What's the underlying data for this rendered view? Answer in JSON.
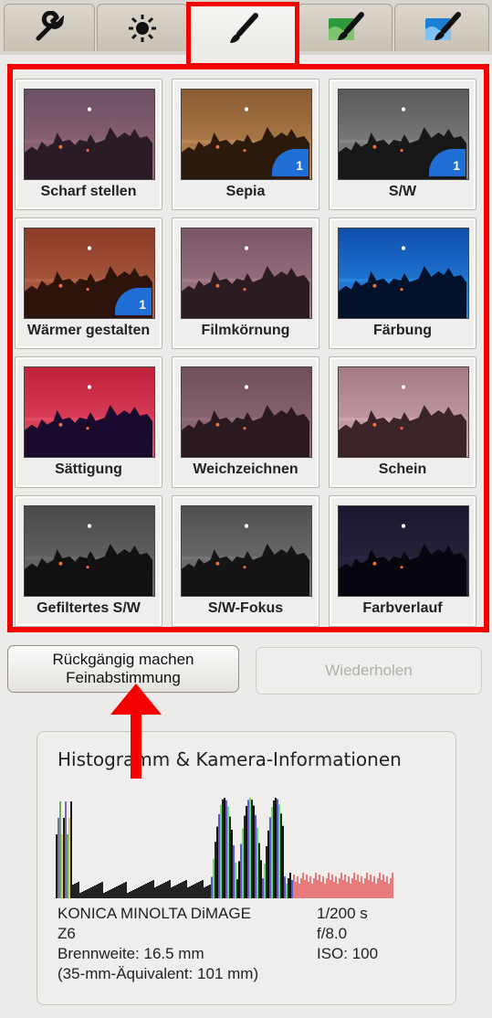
{
  "tabs": [
    {
      "name": "tab-tools",
      "icon": "wrench-icon",
      "active": false
    },
    {
      "name": "tab-adjust",
      "icon": "brightness-icon",
      "active": false
    },
    {
      "name": "tab-effects",
      "icon": "brush-icon",
      "active": true
    },
    {
      "name": "tab-effects-green",
      "icon": "brush-green-icon",
      "active": false
    },
    {
      "name": "tab-effects-blue",
      "icon": "brush-blue-icon",
      "active": false
    }
  ],
  "effects": [
    {
      "label": "Scharf stellen",
      "badge": null
    },
    {
      "label": "Sepia",
      "badge": "1"
    },
    {
      "label": "S/W",
      "badge": "1"
    },
    {
      "label": "Wärmer gestalten",
      "badge": "1"
    },
    {
      "label": "Filmkörnung",
      "badge": null
    },
    {
      "label": "Färbung",
      "badge": null
    },
    {
      "label": "Sättigung",
      "badge": null
    },
    {
      "label": "Weichzeichnen",
      "badge": null
    },
    {
      "label": "Schein",
      "badge": null
    },
    {
      "label": "Gefiltertes S/W",
      "badge": null
    },
    {
      "label": "S/W-Fokus",
      "badge": null
    },
    {
      "label": "Farbverlauf",
      "badge": null
    }
  ],
  "buttons": {
    "undo_line1": "Rückgängig machen",
    "undo_line2": "Feinabstimmung",
    "redo": "Wiederholen"
  },
  "panel": {
    "title": "Histogramm & Kamera-Informationen",
    "camera_line1": "KONICA MINOLTA  DiMAGE",
    "camera_line2": "Z6",
    "focal": "Brennweite: 16.5 mm",
    "equiv": "(35-mm-Äquivalent: 101 mm)",
    "shutter": "1/200 s",
    "aperture": "f/8.0",
    "iso": "ISO: 100"
  },
  "colors": {
    "highlight": "#f40000",
    "badge": "#1f6fd6"
  }
}
